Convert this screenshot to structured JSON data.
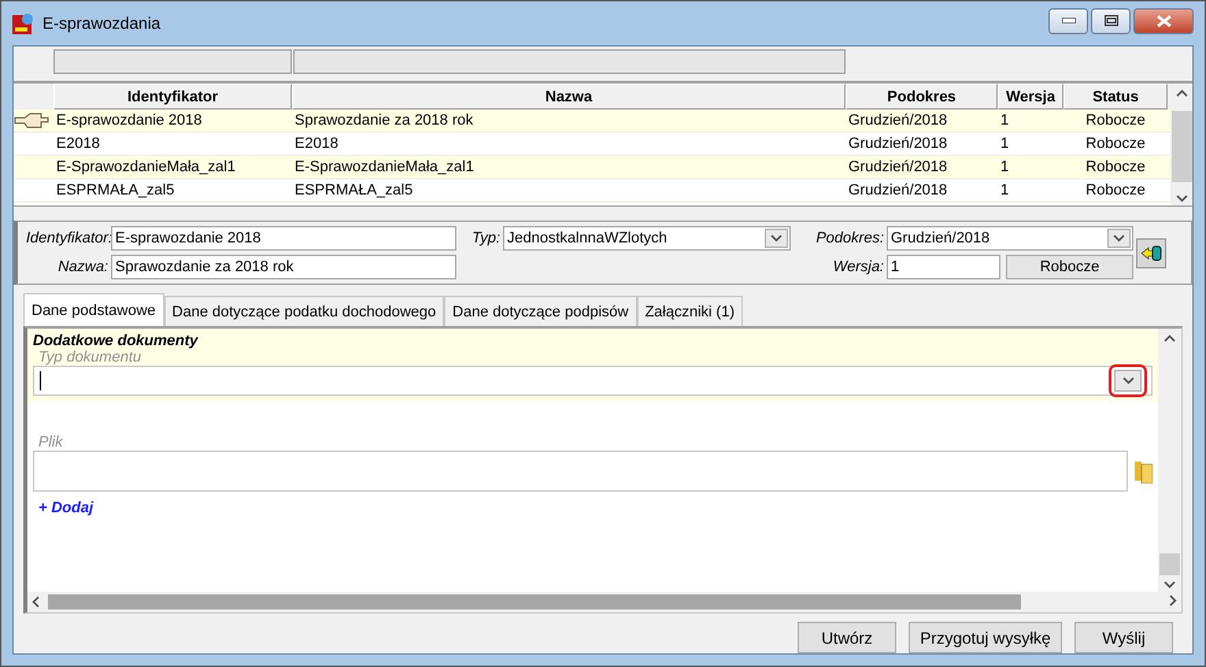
{
  "window": {
    "title": "E-sprawozdania"
  },
  "table": {
    "columns": [
      "Identyfikator",
      "Nazwa",
      "Podokres",
      "Wersja",
      "Status"
    ],
    "rows": [
      {
        "cells": [
          "E-sprawozdanie 2018",
          "Sprawozdanie za 2018 rok",
          "Grudzień/2018",
          "1",
          "Robocze"
        ],
        "selected": true
      },
      {
        "cells": [
          "E2018",
          "E2018",
          "Grudzień/2018",
          "1",
          "Robocze"
        ],
        "selected": false
      },
      {
        "cells": [
          "E-SprawozdanieMała_zal1",
          "E-SprawozdanieMała_zal1",
          "Grudzień/2018",
          "1",
          "Robocze"
        ],
        "selected": false
      },
      {
        "cells": [
          "ESPRMAŁA_zal5",
          "ESPRMAŁA_zal5",
          "Grudzień/2018",
          "1",
          "Robocze"
        ],
        "selected": false
      }
    ]
  },
  "form": {
    "identyfikator_label": "Identyfikator:",
    "identyfikator": "E-sprawozdanie 2018",
    "nazwa_label": "Nazwa:",
    "nazwa": "Sprawozdanie za 2018 rok",
    "typ_label": "Typ:",
    "typ": "JednostkalnnaWZlotych",
    "podokres_label": "Podokres:",
    "podokres": "Grudzień/2018",
    "wersja_label": "Wersja:",
    "wersja": "1",
    "status_button": "Robocze"
  },
  "tabs": [
    {
      "label": "Dane podstawowe",
      "selected": true
    },
    {
      "label": "Dane dotyczące podatku dochodowego",
      "selected": false
    },
    {
      "label": "Dane dotyczące podpisów",
      "selected": false
    },
    {
      "label": "Załączniki (1)",
      "selected": false
    }
  ],
  "content": {
    "section_title": "Dodatkowe dokumenty",
    "typ_dokumentu_label": "Typ dokumentu",
    "dropdown_highlighted": true,
    "plik_label": "Plik",
    "add_link": "+ Dodaj"
  },
  "buttons": [
    "Utwórz",
    "Przygotuj wysyłkę",
    "Wyślij"
  ]
}
